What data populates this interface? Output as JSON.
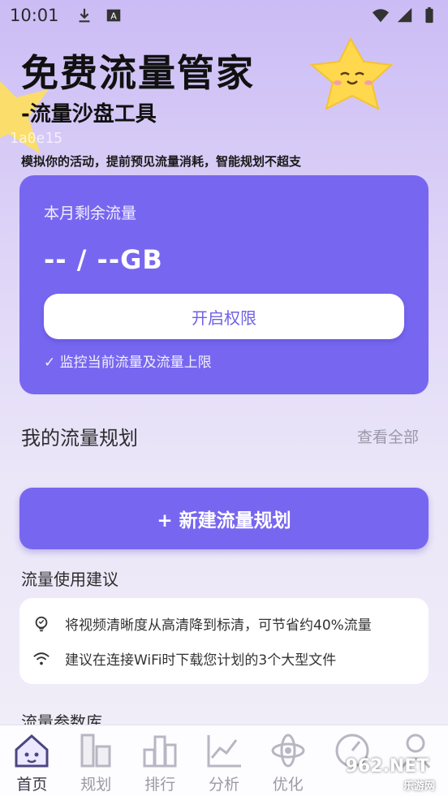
{
  "status_bar": {
    "time": "10:01",
    "left_icons": [
      "download-icon",
      "a-badge-icon"
    ],
    "right_icons": [
      "wifi-icon",
      "signal-icon",
      "battery-icon"
    ]
  },
  "hero": {
    "title": "免费流量管家",
    "subtitle": "-流量沙盘工具",
    "watermark": "1a0e15",
    "description": "模拟你的活动，提前预见流量消耗，智能规划不超支"
  },
  "traffic_card": {
    "label": "本月剩余流量",
    "value": "-- / --GB",
    "button_label": "开启权限",
    "note": "✓ 监控当前流量及流量上限"
  },
  "plans_section": {
    "title": "我的流量规划",
    "view_all": "查看全部",
    "new_plan_label": "+ 新建流量规划"
  },
  "tips": {
    "title": "流量使用建议",
    "items": [
      {
        "icon": "lightbulb-icon",
        "text": "将视频清晰度从高清降到标清，可节省约40%流量"
      },
      {
        "icon": "wifi-icon",
        "text": "建议在连接WiFi时下载您计划的3个大型文件"
      }
    ]
  },
  "params": {
    "title": "流量参数库"
  },
  "tab_bar": {
    "items": [
      {
        "label": "首页",
        "icon": "home-icon",
        "active": true
      },
      {
        "label": "规划",
        "icon": "plan-icon",
        "active": false
      },
      {
        "label": "排行",
        "icon": "ranking-icon",
        "active": false
      },
      {
        "label": "分析",
        "icon": "analysis-icon",
        "active": false
      },
      {
        "label": "优化",
        "icon": "optimize-icon",
        "active": false
      },
      {
        "label": "",
        "icon": "gauge-icon",
        "active": false
      },
      {
        "label": "",
        "icon": "profile-icon",
        "active": false
      }
    ]
  },
  "watermark_badge": {
    "text": "962.NET",
    "sub": "乐游网"
  },
  "colors": {
    "accent": "#7767f0",
    "background_top": "#cbbcf5",
    "tab_inactive": "#9c9aa6"
  }
}
